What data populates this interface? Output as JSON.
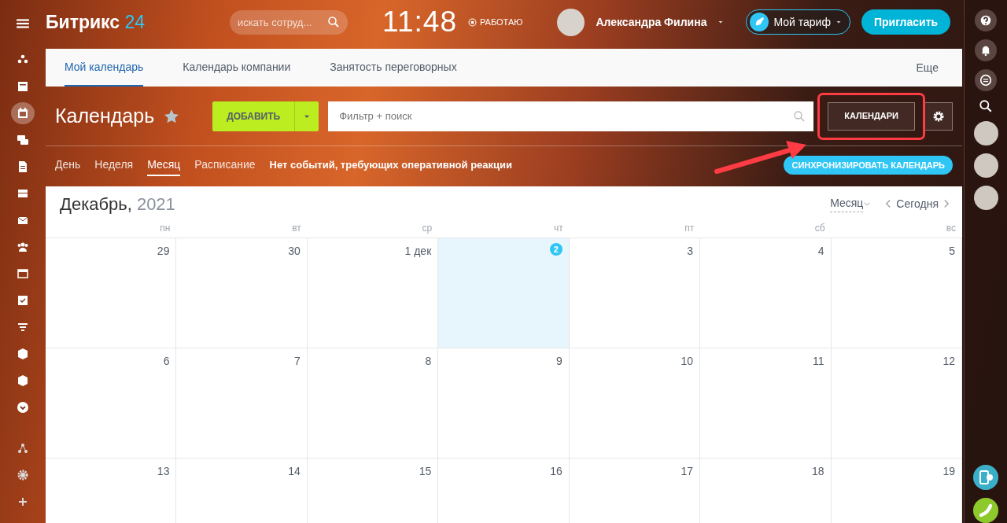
{
  "header": {
    "logo": {
      "name": "Битрикс",
      "suffix": "24"
    },
    "search": {
      "placeholder": "искать сотруд..."
    },
    "clock": "11:48",
    "work_status": "РАБОТАЮ",
    "user": {
      "name": "Александра Филина"
    },
    "tariff_button": "Мой тариф",
    "invite_button": "Пригласить"
  },
  "left_menu": [
    {
      "kind": "activity",
      "selected": false
    },
    {
      "kind": "feed",
      "selected": false
    },
    {
      "kind": "calendar",
      "selected": true
    },
    {
      "kind": "chat",
      "selected": false
    },
    {
      "kind": "document",
      "selected": false
    },
    {
      "kind": "drive",
      "selected": false
    },
    {
      "kind": "mail",
      "selected": false
    },
    {
      "kind": "people",
      "selected": false
    },
    {
      "kind": "window",
      "selected": false
    },
    {
      "kind": "task",
      "selected": false
    },
    {
      "kind": "funnel",
      "selected": false
    },
    {
      "kind": "cube",
      "selected": false
    },
    {
      "kind": "cube",
      "selected": false
    },
    {
      "kind": "more",
      "selected": false
    },
    {
      "kind": "structure",
      "selected": false
    },
    {
      "kind": "settings",
      "selected": false
    },
    {
      "kind": "plus",
      "selected": false
    }
  ],
  "tabs": [
    {
      "label": "Мой календарь",
      "selected": true
    },
    {
      "label": "Календарь компании",
      "selected": false
    },
    {
      "label": "Занятость переговорных",
      "selected": false
    }
  ],
  "more_menu": "Еще",
  "toolbar": {
    "title": "Календарь",
    "add_button": "ДОБАВИТЬ",
    "filter": {
      "placeholder": "Фильтр + поиск"
    },
    "calendars_button": "КАЛЕНДАРИ"
  },
  "views": [
    {
      "label": "День",
      "selected": false
    },
    {
      "label": "Неделя",
      "selected": false
    },
    {
      "label": "Месяц",
      "selected": true
    },
    {
      "label": "Расписание",
      "selected": false
    }
  ],
  "notice": "Нет событий, требующих оперативной реакции",
  "sync_button": "СИНХРОНИЗИРОВАТЬ КАЛЕНДАРЬ",
  "annotation": {
    "kind": "frame-with-arrow"
  },
  "calendar": {
    "month": "Декабрь,",
    "year": "2021",
    "view_selector": "Месяц",
    "today_button": "Сегодня",
    "weekdays": [
      "пн",
      "вт",
      "ср",
      "чт",
      "пт",
      "сб",
      "вс"
    ],
    "weeks": [
      [
        {
          "day": "29",
          "today": false
        },
        {
          "day": "30",
          "today": false
        },
        {
          "day": "1 дек",
          "today": false
        },
        {
          "day": "2",
          "today": true
        },
        {
          "day": "3",
          "today": false
        },
        {
          "day": "4",
          "today": false
        },
        {
          "day": "5",
          "today": false
        }
      ],
      [
        {
          "day": "6",
          "today": false
        },
        {
          "day": "7",
          "today": false
        },
        {
          "day": "8",
          "today": false
        },
        {
          "day": "9",
          "today": false
        },
        {
          "day": "10",
          "today": false
        },
        {
          "day": "11",
          "today": false
        },
        {
          "day": "12",
          "today": false
        }
      ],
      [
        {
          "day": "13",
          "today": false
        },
        {
          "day": "14",
          "today": false
        },
        {
          "day": "15",
          "today": false
        },
        {
          "day": "16",
          "today": false
        },
        {
          "day": "17",
          "today": false
        },
        {
          "day": "18",
          "today": false
        },
        {
          "day": "19",
          "today": false
        }
      ]
    ]
  },
  "right_bar": [
    {
      "kind": "help"
    },
    {
      "kind": "bell"
    },
    {
      "kind": "chat"
    },
    {
      "kind": "search"
    },
    {
      "kind": "avatar"
    },
    {
      "kind": "avatar"
    },
    {
      "kind": "avatar"
    },
    {
      "kind": "cloud-phone"
    },
    {
      "kind": "phone"
    }
  ]
}
